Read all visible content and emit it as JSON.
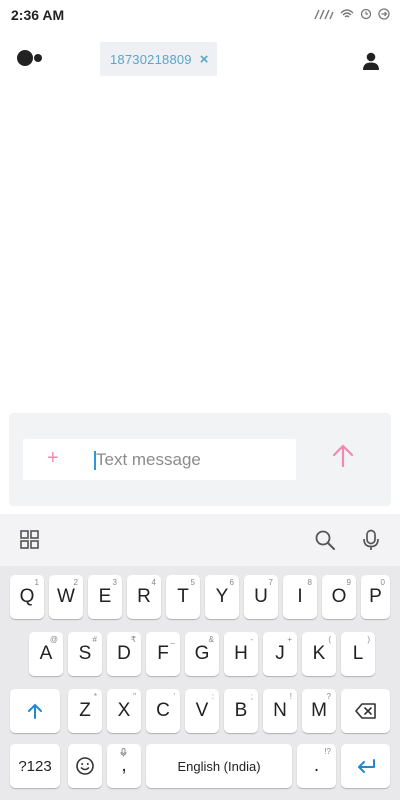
{
  "status_bar": {
    "time": "2:36 AM",
    "icons": [
      "signal-icon",
      "wifi-icon",
      "alarm-icon",
      "battery-icon"
    ]
  },
  "header": {
    "recipient": "18730218809",
    "remove_symbol": "×"
  },
  "compose": {
    "placeholder": "Text message",
    "plus_symbol": "+"
  },
  "keyboard": {
    "row1": [
      {
        "label": "Q",
        "hint": "1"
      },
      {
        "label": "W",
        "hint": "2"
      },
      {
        "label": "E",
        "hint": "3"
      },
      {
        "label": "R",
        "hint": "4"
      },
      {
        "label": "T",
        "hint": "5"
      },
      {
        "label": "Y",
        "hint": "6"
      },
      {
        "label": "U",
        "hint": "7"
      },
      {
        "label": "I",
        "hint": "8"
      },
      {
        "label": "O",
        "hint": "9"
      },
      {
        "label": "P",
        "hint": "0"
      }
    ],
    "row2": [
      {
        "label": "A",
        "hint": "@"
      },
      {
        "label": "S",
        "hint": "#"
      },
      {
        "label": "D",
        "hint": "₹"
      },
      {
        "label": "F",
        "hint": "_"
      },
      {
        "label": "G",
        "hint": "&"
      },
      {
        "label": "H",
        "hint": "-"
      },
      {
        "label": "J",
        "hint": "+"
      },
      {
        "label": "K",
        "hint": "("
      },
      {
        "label": "L",
        "hint": ")"
      }
    ],
    "row3": [
      {
        "label": "Z",
        "hint": "*"
      },
      {
        "label": "X",
        "hint": "\""
      },
      {
        "label": "C",
        "hint": "'"
      },
      {
        "label": "V",
        "hint": ":"
      },
      {
        "label": "B",
        "hint": ";"
      },
      {
        "label": "N",
        "hint": "!"
      },
      {
        "label": "M",
        "hint": "?"
      }
    ],
    "symbols_label": "?123",
    "comma_label": ",",
    "space_label": "English (India)",
    "period_label": ".",
    "period_hint": "!?"
  },
  "colors": {
    "accent_pink": "#f08ab0",
    "accent_blue": "#1e88d4",
    "chip_text": "#5aa6c8"
  }
}
